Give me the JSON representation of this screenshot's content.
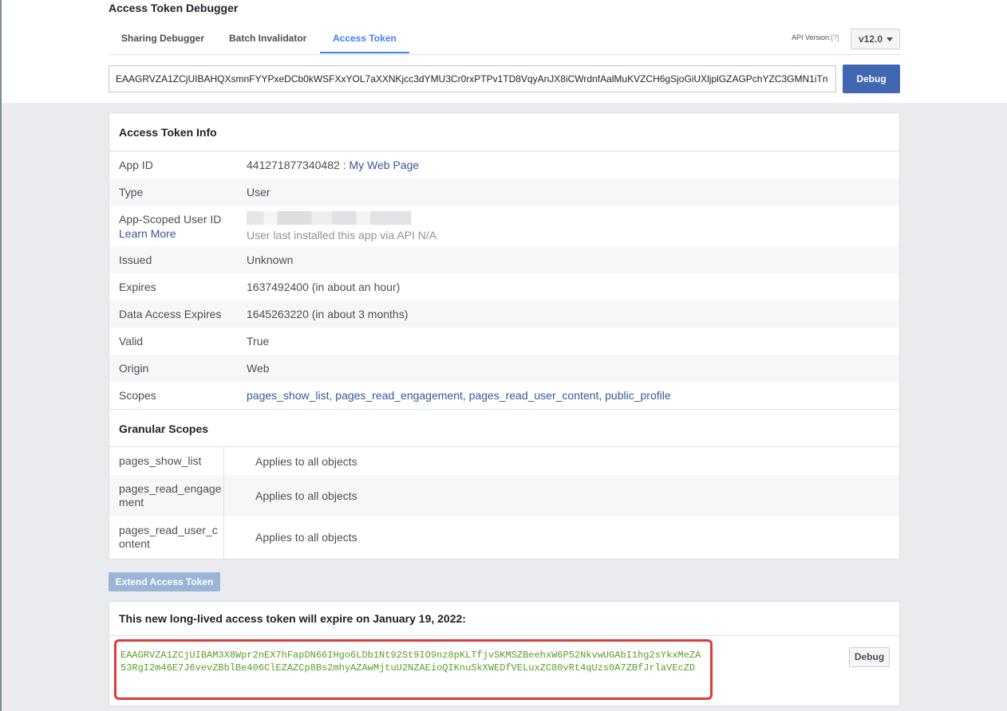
{
  "page_title": "Access Token Debugger",
  "tabs": [
    {
      "label": "Sharing Debugger"
    },
    {
      "label": "Batch Invalidator"
    },
    {
      "label": "Access Token"
    }
  ],
  "api": {
    "label": "API Version:",
    "help": "[?]",
    "version": "v12.0"
  },
  "token_input": {
    "value": "EAAGRVZA1ZCjUIBAHQXsmnFYYPxeDCb0kWSFXxYOL7aXXNKjcc3dYMU3Cr0rxPTPv1TD8VqyAnJX8iCWrdnfAalMuKVZCH6gSjoGiUXljplGZAGPchYZC3GMN1iTn"
  },
  "debug_label": "Debug",
  "info": {
    "title": "Access Token Info",
    "app_id": {
      "label": "App ID",
      "id": "441271877340482",
      "sep": " : ",
      "name": "My Web Page"
    },
    "type": {
      "label": "Type",
      "value": "User"
    },
    "scoped_user": {
      "label": "App-Scoped User ID",
      "learn_more": "Learn More",
      "note": "User last installed this app via API N/A"
    },
    "issued": {
      "label": "Issued",
      "value": "Unknown"
    },
    "expires": {
      "label": "Expires",
      "value": "1637492400 (in about an hour)"
    },
    "data_expires": {
      "label": "Data Access Expires",
      "value": "1645263220 (in about 3 months)"
    },
    "valid": {
      "label": "Valid",
      "value": "True"
    },
    "origin": {
      "label": "Origin",
      "value": "Web"
    },
    "scopes": {
      "label": "Scopes",
      "items": [
        "pages_show_list",
        "pages_read_engagement",
        "pages_read_user_content",
        "public_profile"
      ],
      "sep": ", "
    }
  },
  "granular": {
    "title": "Granular Scopes",
    "rows": [
      {
        "scope": "pages_show_list",
        "value": "Applies to all objects"
      },
      {
        "scope": "pages_read_engagement",
        "value": "Applies to all objects"
      },
      {
        "scope": "pages_read_user_content",
        "value": "Applies to all objects"
      }
    ]
  },
  "extend_label": "Extend Access Token",
  "long_lived": {
    "title": "This new long-lived access token will expire on January 19, 2022:",
    "token": "EAAGRVZA1ZCjUIBAM3X8Wpr2nEX7hFapDN66IHgo6LDb1Nt92St9IO9nz8pKLTfjvSKMSZBeehxW6P52NkvwUGAbI1hg2sYkxMeZA53RgI2m46E7J6vevZBblBe406ClEZAZCp8Bs2mhyAZAwMjtuU2NZAEioQIKnuSkXWEDfVELuxZC80vRt4qUzs0A7ZBfJrlaVEcZD",
    "debug_label": "Debug"
  },
  "colors": {
    "accent": "#4080ff",
    "brand_button": "#4267b2",
    "link": "#365899",
    "token_green": "#5a9e2a",
    "highlight_red": "#e03a3a"
  }
}
